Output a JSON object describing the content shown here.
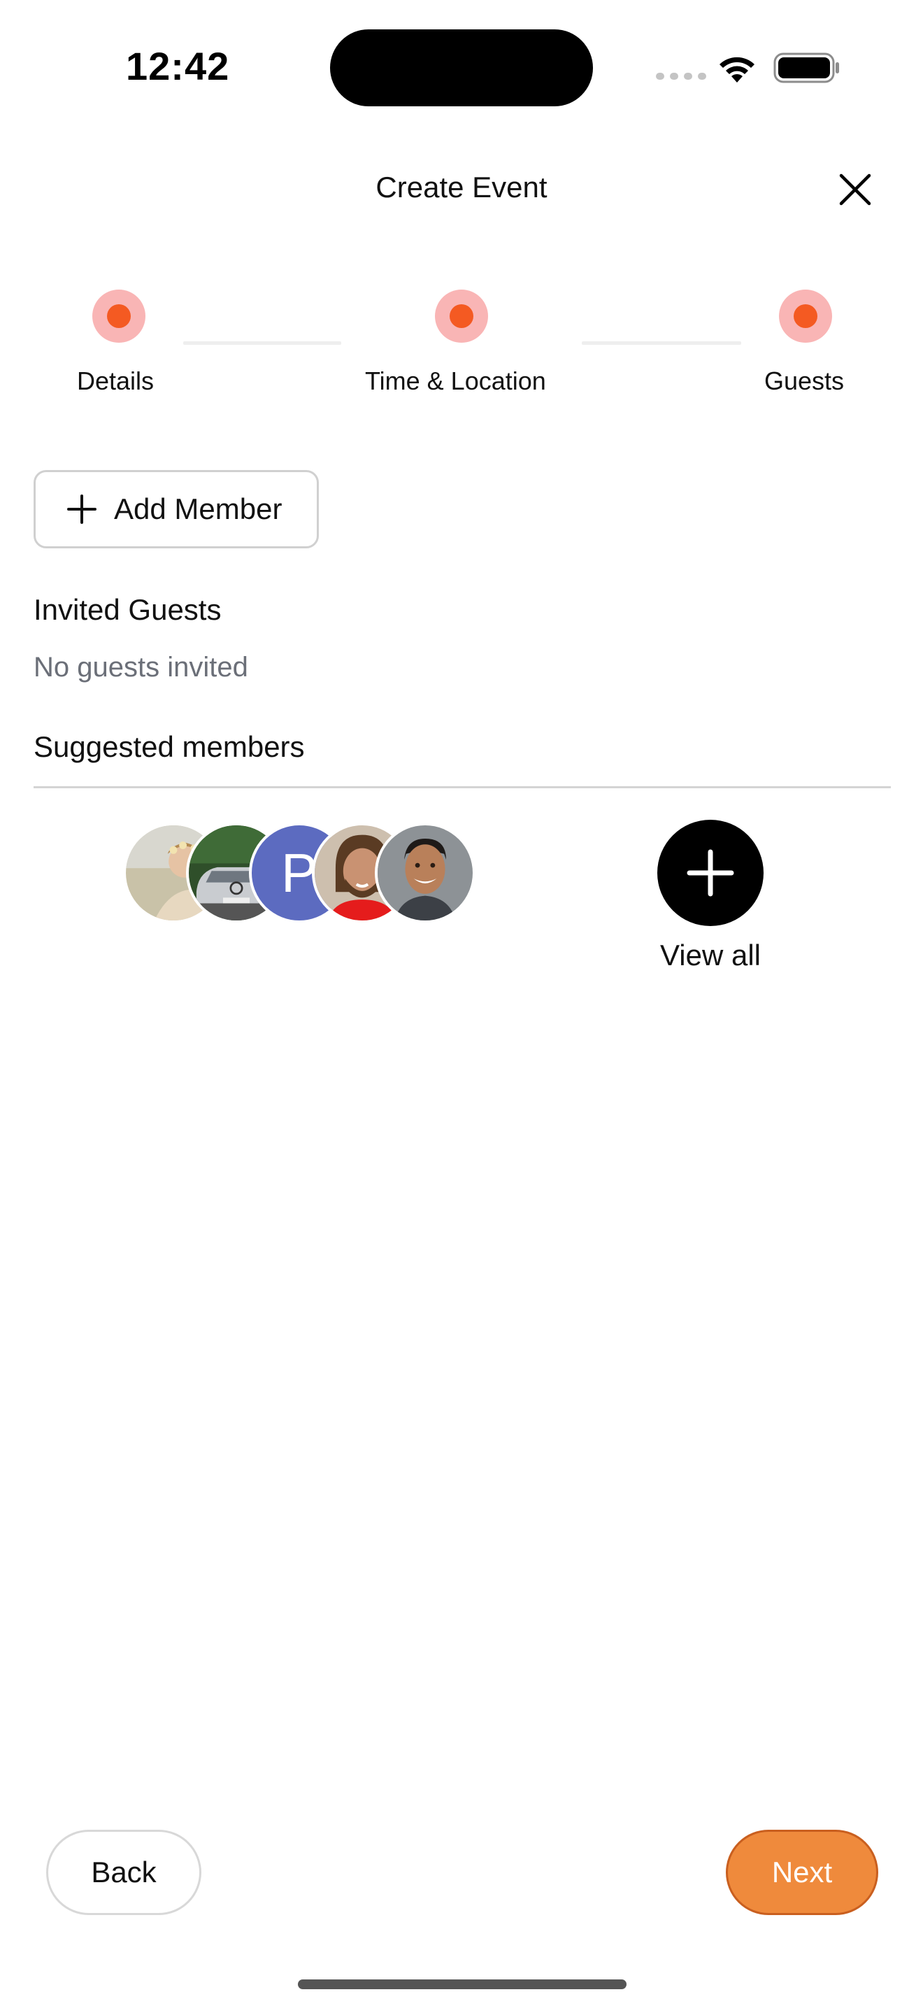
{
  "status_bar": {
    "time": "12:42"
  },
  "header": {
    "title": "Create Event",
    "close_icon": "close-icon"
  },
  "stepper": {
    "steps": [
      {
        "label": "Details"
      },
      {
        "label": "Time & Location"
      },
      {
        "label": "Guests"
      }
    ],
    "active_color": "#f45a22",
    "ring_color": "#f9b5b5"
  },
  "add_member": {
    "label": "Add Member",
    "icon": "plus-icon"
  },
  "invited_guests": {
    "title": "Invited Guests",
    "empty_text": "No guests invited"
  },
  "suggested_members": {
    "title": "Suggested members",
    "avatars": [
      {
        "type": "photo",
        "icon": "avatar-photo-woman"
      },
      {
        "type": "photo",
        "icon": "avatar-photo-car"
      },
      {
        "type": "letter",
        "letter": "P",
        "color": "#5c6bc0"
      },
      {
        "type": "photo",
        "icon": "avatar-photo-man-beard"
      },
      {
        "type": "photo",
        "icon": "avatar-photo-man-smile"
      }
    ],
    "view_all_label": "View all"
  },
  "footer": {
    "back_label": "Back",
    "next_label": "Next",
    "next_color": "#ef8a3c"
  }
}
